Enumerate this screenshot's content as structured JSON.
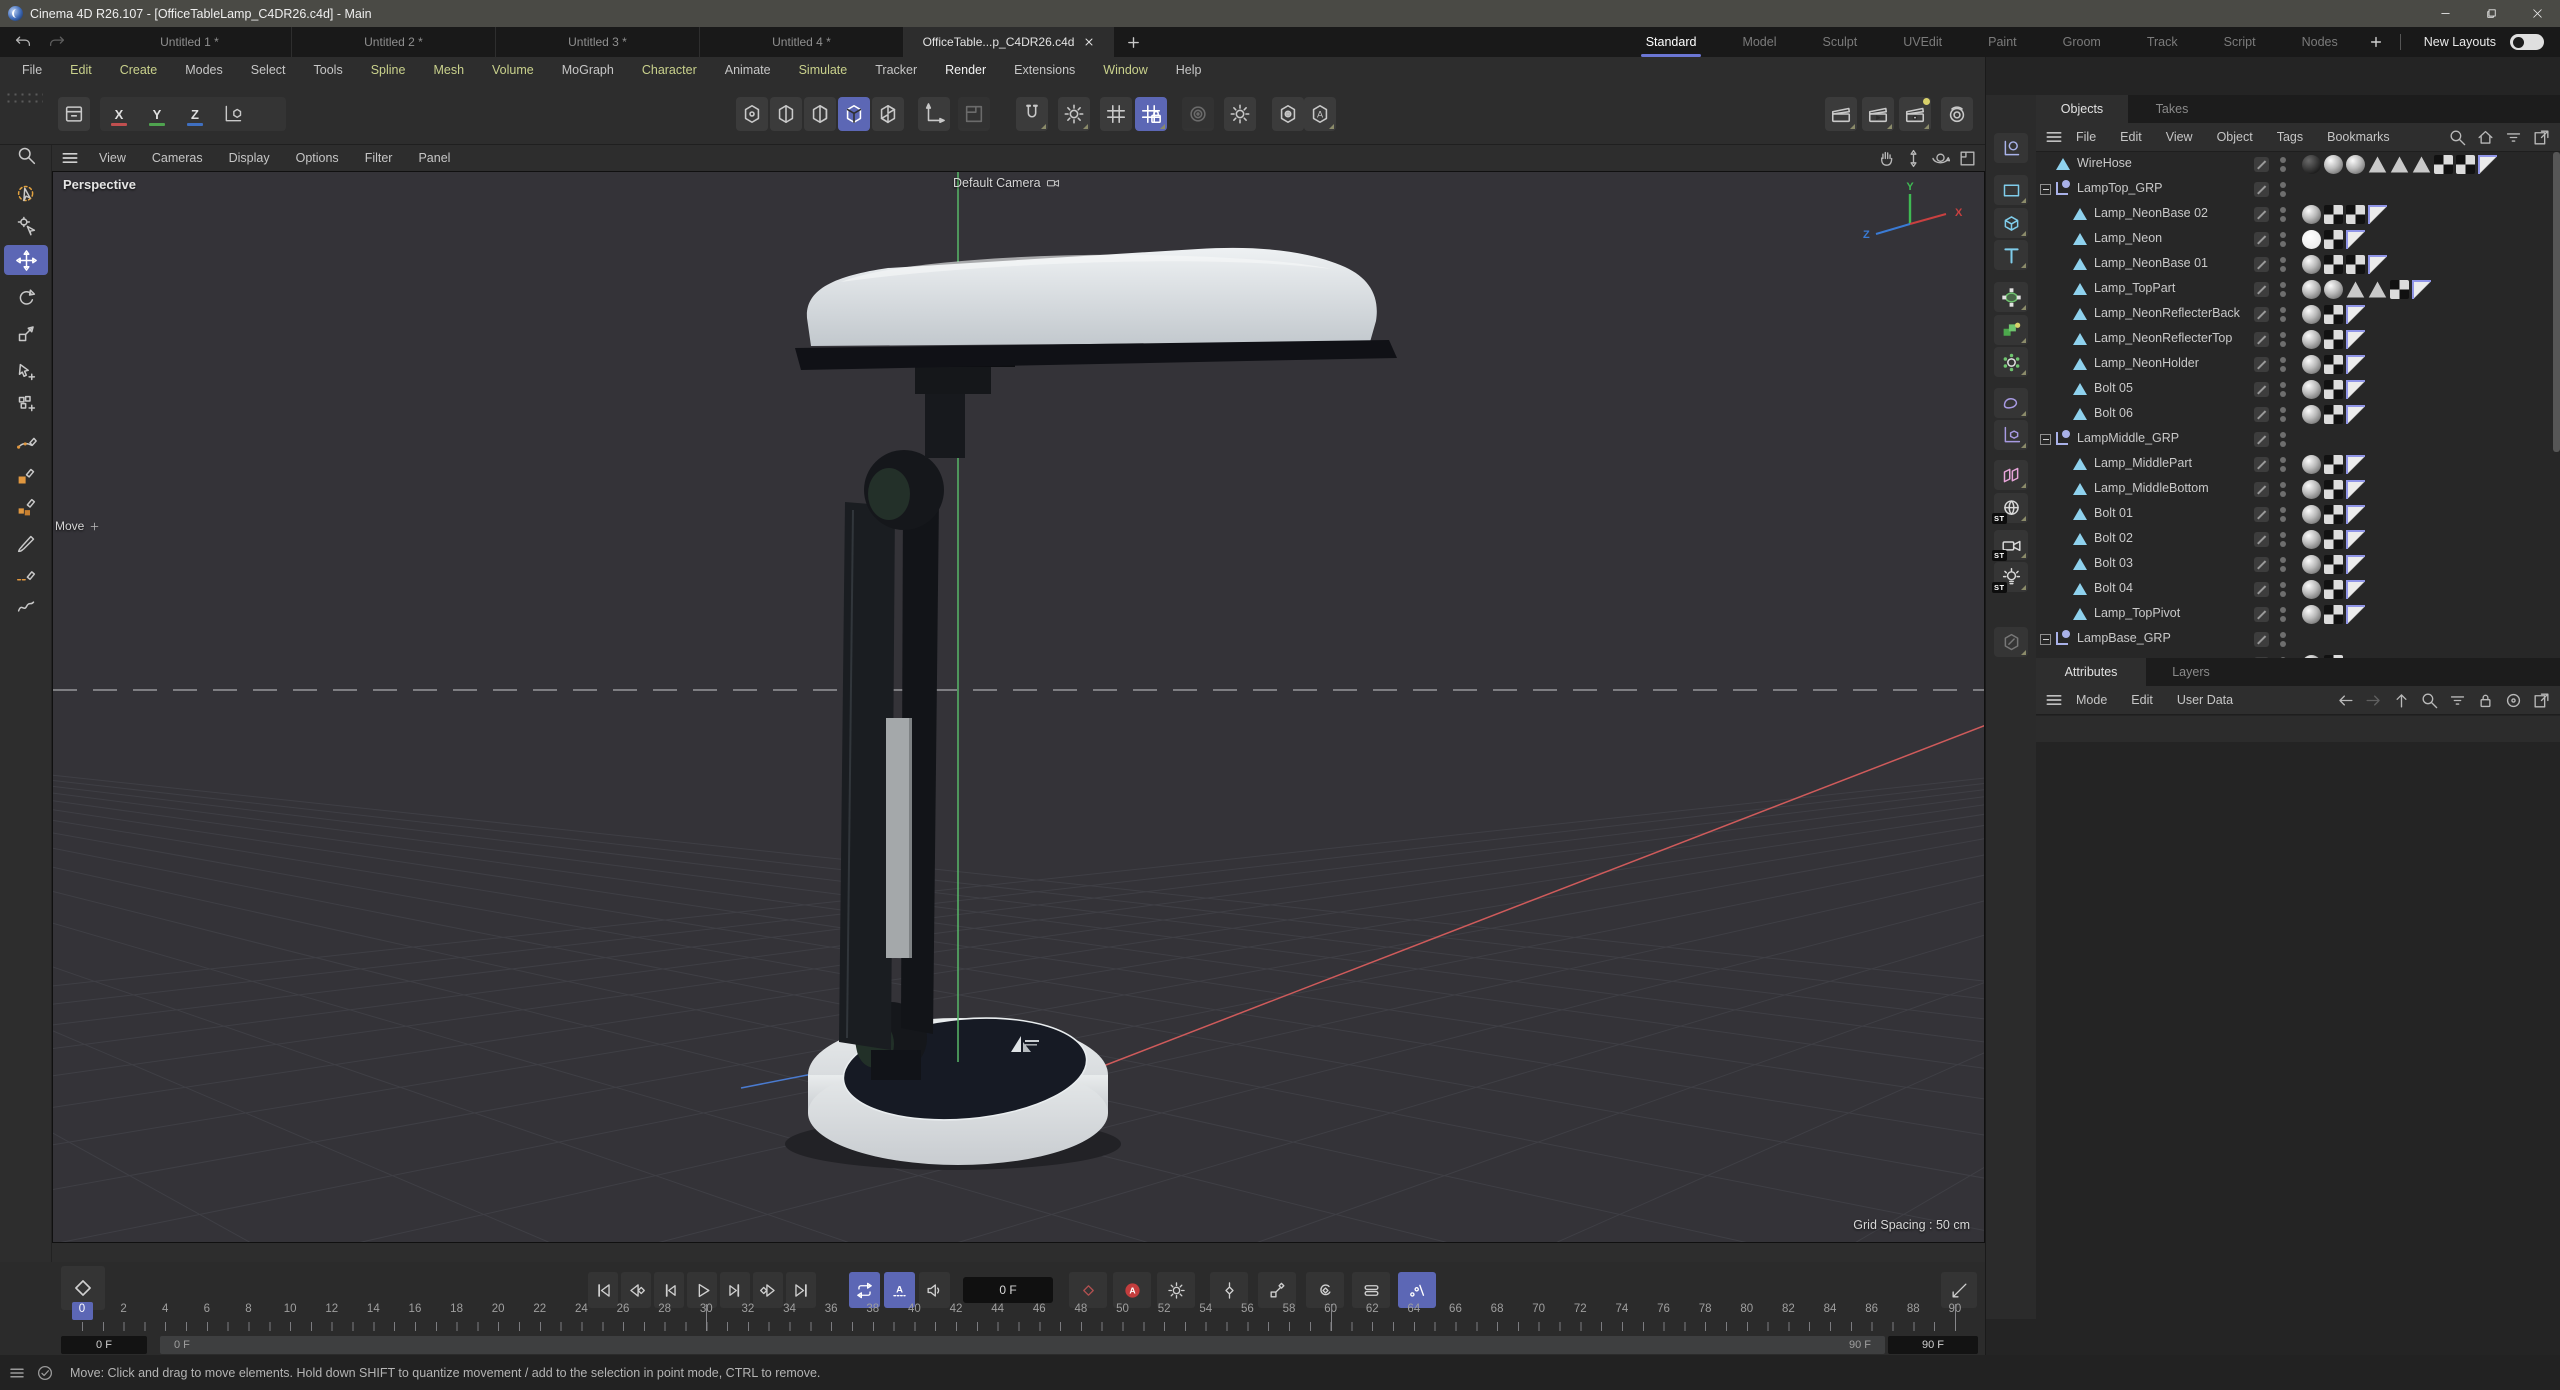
{
  "window": {
    "title": "Cinema 4D R26.107 - [OfficeTableLamp_C4DR26.c4d] - Main"
  },
  "doc_tabs": {
    "items": [
      "Untitled 1 *",
      "Untitled 2 *",
      "Untitled 3 *",
      "Untitled 4 *"
    ],
    "active": "OfficeTable...p_C4DR26.c4d"
  },
  "layout_tabs": {
    "items": [
      "Standard",
      "Model",
      "Sculpt",
      "UVEdit",
      "Paint",
      "Groom",
      "Track",
      "Script",
      "Nodes"
    ],
    "active": "Standard",
    "new_layouts": "New Layouts"
  },
  "menu_bar": [
    {
      "label": "File",
      "tone": "plain"
    },
    {
      "label": "Edit",
      "tone": "accent"
    },
    {
      "label": "Create",
      "tone": "accent"
    },
    {
      "label": "Modes",
      "tone": "plain"
    },
    {
      "label": "Select",
      "tone": "plain"
    },
    {
      "label": "Tools",
      "tone": "plain"
    },
    {
      "label": "Spline",
      "tone": "accent"
    },
    {
      "label": "Mesh",
      "tone": "accent"
    },
    {
      "label": "Volume",
      "tone": "accent"
    },
    {
      "label": "MoGraph",
      "tone": "plain"
    },
    {
      "label": "Character",
      "tone": "accent"
    },
    {
      "label": "Animate",
      "tone": "plain"
    },
    {
      "label": "Simulate",
      "tone": "accent"
    },
    {
      "label": "Tracker",
      "tone": "plain"
    },
    {
      "label": "Render",
      "tone": "bright"
    },
    {
      "label": "Extensions",
      "tone": "plain"
    },
    {
      "label": "Window",
      "tone": "accent"
    },
    {
      "label": "Help",
      "tone": "plain"
    }
  ],
  "toolbar": {
    "axis_buttons": [
      "X",
      "Y",
      "Z"
    ],
    "center": [
      "points-mode",
      "edges-mode",
      "polygons-mode",
      "model-mode",
      "texture-mode",
      "enable-axis",
      "workplane-mode",
      "snap-toggle",
      "snap-settings",
      "grid-toggle",
      "quantize-toggle",
      "modeling-ring",
      "modeling-settings",
      "viewport-filter",
      "auto-tool"
    ],
    "render_buttons": [
      "render-view",
      "render-region",
      "render-settings",
      "interactive-render"
    ]
  },
  "left_toolbar": [
    "zoom-tool",
    "live-selection-tool",
    "tweak-selection-tool",
    "move-tool",
    "rotate-tool",
    "scale-tool",
    "tweak-move-tool",
    "multi-move-tool",
    "spline-pen-tool",
    "sketch-tool",
    "polygon-pen-tool",
    "brush-tool",
    "line-cut-tool",
    "spline-smooth-tool"
  ],
  "left_toolbar_active": "move-tool",
  "create_strip": [
    "null-object",
    "spline-primitive",
    "cube-primitive",
    "text-object",
    "subdivision-surface",
    "volume-builder",
    "array-object",
    "sculpt-object",
    "workplane-object",
    "instance-object",
    "sky-object",
    "camera-object",
    "light-object",
    "material-node"
  ],
  "create_strip_badge": "ST",
  "viewport": {
    "menu": [
      "View",
      "Cameras",
      "Display",
      "Options",
      "Filter",
      "Panel"
    ],
    "view_label": "Perspective",
    "camera_label": "Default Camera",
    "tool_label": "Move",
    "grid_spacing": "Grid Spacing : 50 cm",
    "axis_x": "X",
    "axis_y": "Y",
    "axis_z": "Z"
  },
  "objects_panel": {
    "tabs": [
      "Objects",
      "Takes"
    ],
    "active_tab": "Objects",
    "menu": [
      "File",
      "Edit",
      "View",
      "Object",
      "Tags",
      "Bookmarks"
    ],
    "tree": [
      {
        "name": "WireHose",
        "type": "poly",
        "indent": 0,
        "expander": false,
        "tags": [
          "md",
          "m",
          "m",
          "ph",
          "ph",
          "ph",
          "uv",
          "uv",
          "fl"
        ]
      },
      {
        "name": "LampTop_GRP",
        "type": "group",
        "indent": 0,
        "expander": true,
        "tags": []
      },
      {
        "name": "Lamp_NeonBase 02",
        "type": "poly",
        "indent": 1,
        "expander": false,
        "tags": [
          "m",
          "uv",
          "uv",
          "fl"
        ]
      },
      {
        "name": "Lamp_Neon",
        "type": "poly",
        "indent": 1,
        "expander": false,
        "tags": [
          "mw",
          "uv",
          "fl"
        ]
      },
      {
        "name": "Lamp_NeonBase 01",
        "type": "poly",
        "indent": 1,
        "expander": false,
        "tags": [
          "m",
          "uv",
          "uv",
          "fl"
        ]
      },
      {
        "name": "Lamp_TopPart",
        "type": "poly",
        "indent": 1,
        "expander": false,
        "tags": [
          "m",
          "m",
          "ph",
          "ph",
          "uv",
          "fl"
        ]
      },
      {
        "name": "Lamp_NeonReflecterBack",
        "type": "poly",
        "indent": 1,
        "expander": false,
        "tags": [
          "m",
          "uv",
          "fl"
        ]
      },
      {
        "name": "Lamp_NeonReflecterTop",
        "type": "poly",
        "indent": 1,
        "expander": false,
        "tags": [
          "m",
          "uv",
          "fl"
        ]
      },
      {
        "name": "Lamp_NeonHolder",
        "type": "poly",
        "indent": 1,
        "expander": false,
        "tags": [
          "m",
          "uv",
          "fl"
        ]
      },
      {
        "name": "Bolt 05",
        "type": "poly",
        "indent": 1,
        "expander": false,
        "tags": [
          "m",
          "uv",
          "fl"
        ]
      },
      {
        "name": "Bolt 06",
        "type": "poly",
        "indent": 1,
        "expander": false,
        "tags": [
          "m",
          "uv",
          "fl"
        ]
      },
      {
        "name": "LampMiddle_GRP",
        "type": "group",
        "indent": 0,
        "expander": true,
        "tags": []
      },
      {
        "name": "Lamp_MiddlePart",
        "type": "poly",
        "indent": 1,
        "expander": false,
        "tags": [
          "m",
          "uv",
          "fl"
        ]
      },
      {
        "name": "Lamp_MiddleBottom",
        "type": "poly",
        "indent": 1,
        "expander": false,
        "tags": [
          "m",
          "uv",
          "fl"
        ]
      },
      {
        "name": "Bolt 01",
        "type": "poly",
        "indent": 1,
        "expander": false,
        "tags": [
          "m",
          "uv",
          "fl"
        ]
      },
      {
        "name": "Bolt 02",
        "type": "poly",
        "indent": 1,
        "expander": false,
        "tags": [
          "m",
          "uv",
          "fl"
        ]
      },
      {
        "name": "Bolt 03",
        "type": "poly",
        "indent": 1,
        "expander": false,
        "tags": [
          "m",
          "uv",
          "fl"
        ]
      },
      {
        "name": "Bolt 04",
        "type": "poly",
        "indent": 1,
        "expander": false,
        "tags": [
          "m",
          "uv",
          "fl"
        ]
      },
      {
        "name": "Lamp_TopPivot",
        "type": "poly",
        "indent": 1,
        "expander": false,
        "tags": [
          "m",
          "uv",
          "fl"
        ]
      },
      {
        "name": "LampBase_GRP",
        "type": "group",
        "indent": 0,
        "expander": true,
        "tags": []
      },
      {
        "name": "",
        "type": "poly",
        "indent": 1,
        "expander": false,
        "tags": [
          "m",
          "uv"
        ]
      }
    ]
  },
  "attributes_panel": {
    "tabs": [
      "Attributes",
      "Layers"
    ],
    "active_tab": "Attributes",
    "menu": [
      "Mode",
      "Edit",
      "User Data"
    ]
  },
  "timeline": {
    "current_frame_label": "0 F",
    "range_start_label": "0 F",
    "range_in_label": "0 F",
    "range_out_label": "90 F",
    "range_end_label": "90 F",
    "current_frame": 0,
    "ruler_numbers": [
      0,
      2,
      4,
      6,
      8,
      10,
      12,
      14,
      16,
      18,
      20,
      22,
      24,
      26,
      28,
      30,
      32,
      34,
      36,
      38,
      40,
      42,
      44,
      46,
      48,
      50,
      52,
      54,
      56,
      58,
      60,
      62,
      64,
      66,
      68,
      70,
      72,
      74,
      76,
      78,
      80,
      82,
      84,
      86,
      88,
      90
    ],
    "major_ticks": [
      30,
      60,
      90
    ],
    "transport": [
      "go-to-start",
      "go-to-previous-key",
      "go-to-previous-frame",
      "play-forwards",
      "go-to-next-frame",
      "go-to-next-key",
      "go-to-end"
    ],
    "playback_toggles": [
      "loop-playback",
      "play-keyframes",
      "play-sound"
    ],
    "record": [
      "record-keyframe",
      "autokeying",
      "keyframe-selection",
      "record-position",
      "record-scale",
      "record-rotation",
      "record-parameter",
      "record-pla"
    ]
  },
  "status_bar": {
    "text": "Move: Click and drag to move elements. Hold down SHIFT to quantize movement / add to the selection in point mode, CTRL to remove."
  },
  "colors": {
    "accent_blue": "#5c67b5",
    "autokey_red": "#c33d3d",
    "menu_accent": "#c9d18c",
    "axis_x_red": "#cf5b5b",
    "axis_y_green": "#58b868",
    "axis_z_blue": "#4a7bd0"
  }
}
